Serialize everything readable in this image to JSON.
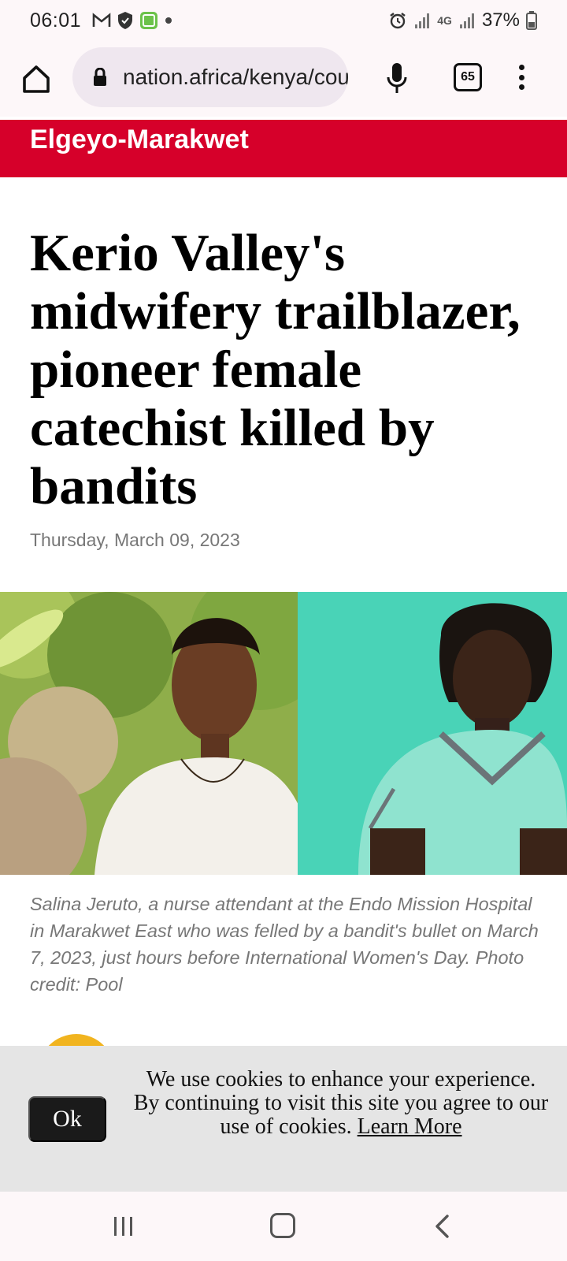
{
  "status_bar": {
    "time": "06:01",
    "battery": "37%",
    "network": "4G",
    "icons": [
      "gmail-icon",
      "shield-icon",
      "app-notification-icon",
      "dot-icon",
      "alarm-icon",
      "signal-icon",
      "signal-icon",
      "battery-icon"
    ]
  },
  "browser": {
    "url": "nation.africa/kenya/counties/elgeyo-marakwet",
    "tab_count": "65"
  },
  "section": {
    "label": "Elgeyo-Marakwet",
    "color": "#d6002a"
  },
  "article": {
    "headline": "Kerio Valley's midwifery trailblazer, pioneer female catechist killed by bandits",
    "date": "Thursday, March 09, 2023",
    "caption": "Salina Jeruto, a nurse attendant at the Endo Mission Hospital in Marakwet East who was felled by a bandit's bullet on March 7, 2023, just hours before International Women's Day. Photo credit: Pool"
  },
  "cookie_banner": {
    "ok_label": "Ok",
    "message": "We use cookies to enhance your experience. By continuing to visit this site you agree to our use of cookies.",
    "link_label": "Learn More"
  },
  "colors": {
    "accent": "#d6002a",
    "avatar": "#f1b41f",
    "teal_background": "#44cfb3"
  }
}
